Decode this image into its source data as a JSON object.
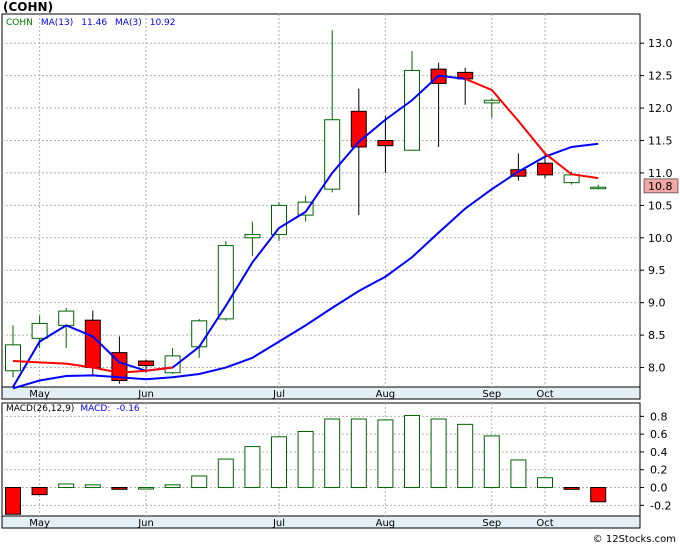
{
  "ticker_title": "(COHN)",
  "copyright": "© 12Stocks.com",
  "chart_data": [
    {
      "type": "candlestick",
      "legend": [
        {
          "text": "COHN",
          "color": "#008000"
        },
        {
          "text": "MA(13)",
          "color": "#0000ff"
        },
        {
          "text": "11.46",
          "color": "#0000ff"
        },
        {
          "text": "MA(3)",
          "color": "#0000ff"
        },
        {
          "text": "10.92",
          "color": "#0000ff"
        }
      ],
      "x_labels": [
        {
          "label": "May",
          "index": 1
        },
        {
          "label": "Jun",
          "index": 5
        },
        {
          "label": "Jul",
          "index": 10
        },
        {
          "label": "Aug",
          "index": 14
        },
        {
          "label": "Sep",
          "index": 18
        },
        {
          "label": "Oct",
          "index": 20
        }
      ],
      "ylim": [
        7.7,
        13.45
      ],
      "y_ticks": [
        8.0,
        8.5,
        9.0,
        9.5,
        10.0,
        10.5,
        11.0,
        11.5,
        12.0,
        12.5,
        13.0
      ],
      "y_tick_labels": [
        "8.0",
        "8.5",
        "9.0",
        "9.5",
        "10.0",
        "10.5",
        "11.0",
        "11.5",
        "12.0",
        "12.5",
        "13.0"
      ],
      "last_price_label": "10.8",
      "last_price": 10.8,
      "candles": [
        {
          "open": 7.95,
          "close": 8.35,
          "high": 8.65,
          "low": 7.85,
          "color": "green"
        },
        {
          "open": 8.45,
          "close": 8.68,
          "high": 8.8,
          "low": 8.3,
          "color": "green"
        },
        {
          "open": 8.65,
          "close": 8.87,
          "high": 8.92,
          "low": 8.3,
          "color": "green"
        },
        {
          "open": 8.73,
          "close": 8.0,
          "high": 8.88,
          "low": 7.88,
          "color": "red"
        },
        {
          "open": 8.23,
          "close": 7.8,
          "high": 8.48,
          "low": 7.75,
          "color": "red"
        },
        {
          "open": 8.1,
          "close": 8.03,
          "high": 8.12,
          "low": 7.92,
          "color": "red"
        },
        {
          "open": 7.92,
          "close": 8.18,
          "high": 8.3,
          "low": 7.9,
          "color": "green"
        },
        {
          "open": 8.32,
          "close": 8.72,
          "high": 8.75,
          "low": 8.15,
          "color": "green"
        },
        {
          "open": 8.75,
          "close": 9.88,
          "high": 9.95,
          "low": 8.72,
          "color": "green"
        },
        {
          "open": 10.0,
          "close": 10.05,
          "high": 10.25,
          "low": 9.72,
          "color": "green"
        },
        {
          "open": 10.05,
          "close": 10.5,
          "high": 10.55,
          "low": 9.95,
          "color": "green"
        },
        {
          "open": 10.35,
          "close": 10.55,
          "high": 10.65,
          "low": 10.25,
          "color": "green"
        },
        {
          "open": 10.75,
          "close": 11.82,
          "high": 13.2,
          "low": 10.7,
          "color": "green"
        },
        {
          "open": 11.95,
          "close": 11.4,
          "high": 12.3,
          "low": 10.35,
          "color": "red"
        },
        {
          "open": 11.5,
          "close": 11.42,
          "high": 11.88,
          "low": 11.0,
          "color": "red"
        },
        {
          "open": 11.35,
          "close": 12.58,
          "high": 12.88,
          "low": 11.35,
          "color": "green"
        },
        {
          "open": 12.6,
          "close": 12.38,
          "high": 12.7,
          "low": 11.4,
          "color": "red"
        },
        {
          "open": 12.55,
          "close": 12.45,
          "high": 12.62,
          "low": 12.05,
          "color": "red"
        },
        {
          "open": 12.12,
          "close": 12.08,
          "high": 12.15,
          "low": 11.85,
          "color": "green"
        },
        {
          "open": 11.05,
          "close": 10.95,
          "high": 11.3,
          "low": 10.88,
          "color": "red"
        },
        {
          "open": 11.15,
          "close": 10.97,
          "high": 11.28,
          "low": 10.92,
          "color": "red"
        },
        {
          "open": 10.85,
          "close": 10.97,
          "high": 11.02,
          "low": 10.82,
          "color": "green"
        },
        {
          "open": 10.77,
          "close": 10.78,
          "high": 10.82,
          "low": 10.75,
          "color": "green"
        }
      ],
      "series": [
        {
          "name": "MA(13)",
          "color": "#0000ff",
          "x": [
            0,
            1,
            2,
            3,
            4,
            5,
            6,
            7,
            8,
            9,
            10,
            11,
            12,
            13,
            14,
            15,
            16,
            17,
            18,
            19,
            20,
            21,
            22
          ],
          "values": [
            7.68,
            7.8,
            7.87,
            7.88,
            7.85,
            7.82,
            7.85,
            7.9,
            8.0,
            8.15,
            8.4,
            8.65,
            8.92,
            9.18,
            9.4,
            9.7,
            10.08,
            10.45,
            10.75,
            11.02,
            11.25,
            11.4,
            11.45
          ]
        },
        {
          "name": "MA(3)",
          "color": "#ff0000",
          "x": [
            0,
            1,
            2,
            3,
            4,
            5,
            6,
            7,
            8,
            9,
            10,
            11,
            12,
            13,
            14,
            15,
            16,
            17,
            18,
            19,
            20,
            21,
            22
          ],
          "values": [
            8.1,
            8.08,
            8.06,
            8.0,
            7.92,
            7.95,
            8.0,
            8.3,
            8.95,
            9.55,
            10.12,
            10.38,
            10.95,
            11.48,
            11.62,
            11.85,
            12.18,
            12.45,
            12.28,
            11.8,
            11.3,
            10.98,
            10.92
          ]
        },
        {
          "name": "MA(13)-upper",
          "color": "#0000ff",
          "x": [
            0,
            1,
            2,
            3,
            4,
            5,
            6,
            7,
            8,
            9,
            10,
            11,
            12,
            13,
            14,
            15,
            16,
            17,
            18,
            19,
            20,
            21,
            22
          ],
          "values": [
            7.7,
            8.4,
            8.65,
            8.48,
            8.08,
            7.95,
            8.0,
            8.32,
            8.95,
            9.62,
            10.15,
            10.4,
            11.0,
            11.48,
            11.82,
            12.12,
            12.5,
            12.45,
            11.8,
            11.25,
            11.35,
            11.42,
            11.46
          ]
        }
      ]
    },
    {
      "type": "bar",
      "legend": [
        {
          "text": "MACD(26,12,9)",
          "color": "#000000"
        },
        {
          "text": "MACD:",
          "color": "#0000ff"
        },
        {
          "text": "-0.16",
          "color": "#0000ff"
        }
      ],
      "ylim": [
        -0.32,
        0.95
      ],
      "y_ticks": [
        0.8,
        0.6,
        0.4,
        0.2,
        0.0,
        -0.2
      ],
      "y_tick_labels": [
        "0.8",
        "0.6",
        "0.4",
        "0.2",
        "0.0",
        "-0.2"
      ],
      "values": [
        -0.3,
        -0.08,
        0.04,
        0.03,
        -0.02,
        0.0,
        0.03,
        0.13,
        0.32,
        0.46,
        0.57,
        0.63,
        0.77,
        0.77,
        0.76,
        0.81,
        0.77,
        0.71,
        0.58,
        0.31,
        0.11,
        -0.02,
        -0.16
      ]
    }
  ]
}
